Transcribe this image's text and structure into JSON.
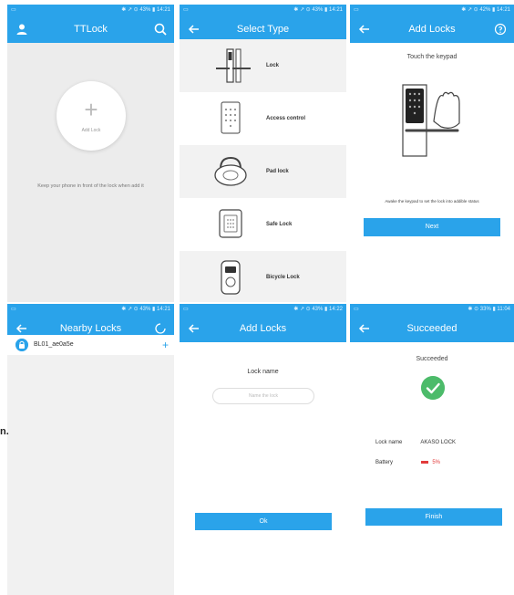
{
  "colors": {
    "primary": "#2aa3ea",
    "success": "#4cbb6a",
    "battery_low": "#e23b3b"
  },
  "statusbars": {
    "s1": "✱ ↗ ⊙ 43% ▮ 14:21",
    "s2": "✱ ↗ ⊙ 43% ▮ 14:21",
    "s3": "✱ ↗ ⊙ 42% ▮ 14:21",
    "s4": "✱ ↗ ⊙ 43% ▮ 14:21",
    "s5": "✱ ↗ ⊙ 43% ▮ 14:22",
    "s6": "✱ ⊙ 33% ▮ 11:04"
  },
  "home": {
    "title": "TTLock",
    "left_icon": "user-icon",
    "right_icon": "search-icon",
    "add_label": "Add Lock",
    "hint": "Keep your phone in front of the lock when add it"
  },
  "select_type": {
    "title": "Select Type",
    "types": [
      {
        "label": "Lock",
        "icon": "door-lock-icon"
      },
      {
        "label": "Access control",
        "icon": "keypad-icon"
      },
      {
        "label": "Pad lock",
        "icon": "padlock-icon"
      },
      {
        "label": "Safe Lock",
        "icon": "safe-icon"
      },
      {
        "label": "Bicycle Lock",
        "icon": "bicycle-lock-icon"
      }
    ]
  },
  "add_locks_touch": {
    "title": "Add Locks",
    "instruction": "Touch the keypad",
    "hint": "Awake the keypad to set the lock into addible status",
    "next": "Next"
  },
  "nearby": {
    "title": "Nearby Locks",
    "items": [
      {
        "name": "BL01_ae0a5e"
      }
    ],
    "side_letter": "n."
  },
  "add_locks_name": {
    "title": "Add Locks",
    "label": "Lock name",
    "placeholder": "Name the lock",
    "ok": "Ok"
  },
  "succeeded": {
    "title": "Succeeded",
    "message": "Succeeded",
    "lock_name_label": "Lock name",
    "lock_name_value": "AKASO LOCK",
    "battery_label": "Battery",
    "battery_value": "5%",
    "finish": "Finish"
  }
}
